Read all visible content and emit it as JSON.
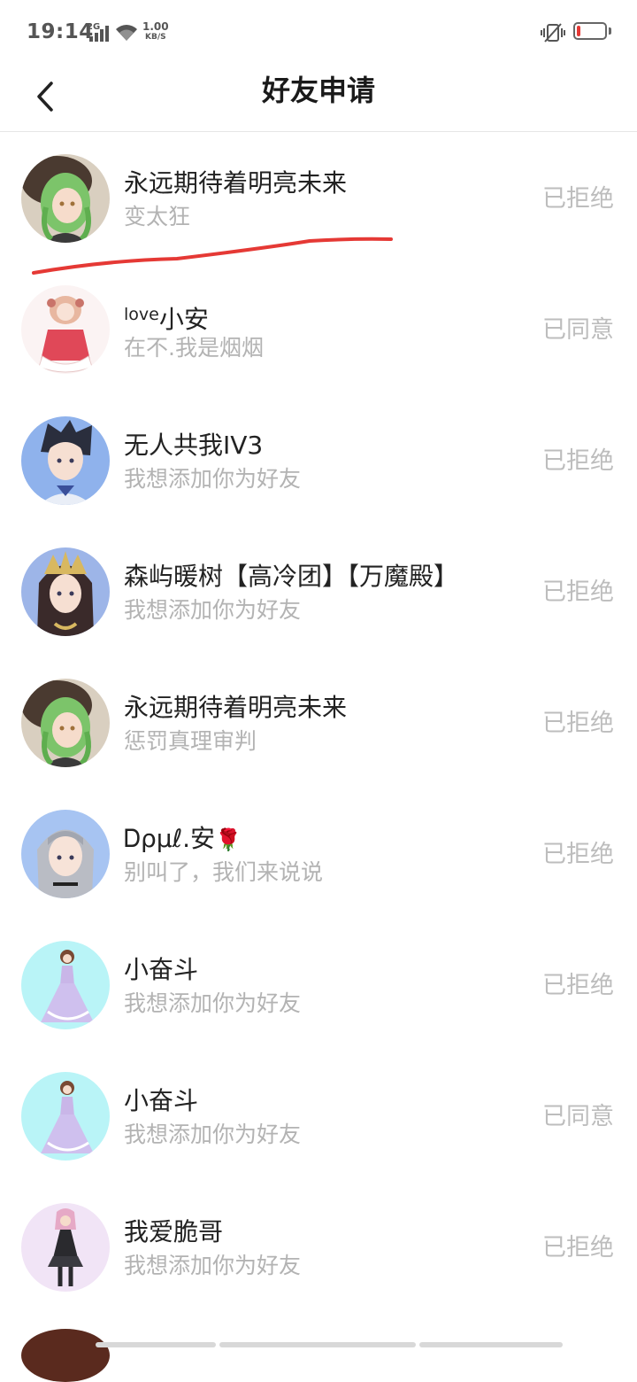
{
  "status_bar": {
    "time": "19:14",
    "network": "2G",
    "speed_value": "1.00",
    "speed_unit": "KB/S",
    "battery_color": "#e53935"
  },
  "header": {
    "title": "好友申请",
    "back_icon": "chevron-left-icon"
  },
  "requests": [
    {
      "name": "永远期待着明亮未来",
      "message": "变太狂",
      "status": "已拒绝",
      "avatar": "green-hair-avatar"
    },
    {
      "name_sup": "love",
      "name": "小安",
      "message": "在不.我是烟烟",
      "status": "已同意",
      "avatar": "pink-dress-avatar"
    },
    {
      "name": "无人共我IV3",
      "message": "我想添加你为好友",
      "status": "已拒绝",
      "avatar": "dark-hair-boy-avatar"
    },
    {
      "name": "森屿暖树【高冷团】【万魔殿】",
      "message": "我想添加你为好友",
      "status": "已拒绝",
      "avatar": "crown-girl-avatar"
    },
    {
      "name": "永远期待着明亮未来",
      "message": "惩罚真理审判",
      "status": "已拒绝",
      "avatar": "green-hair-avatar"
    },
    {
      "name": "Ꭰρμℓ.安",
      "name_emoji": "🌹",
      "message": "别叫了，我们来说说",
      "status": "已拒绝",
      "avatar": "silver-hair-avatar"
    },
    {
      "name": "小奋斗",
      "message": "我想添加你为好友",
      "status": "已拒绝",
      "avatar": "gown-girl-avatar"
    },
    {
      "name": "小奋斗",
      "message": "我想添加你为好友",
      "status": "已同意",
      "avatar": "gown-girl-avatar"
    },
    {
      "name": "我爱脆哥",
      "message": "我想添加你为好友",
      "status": "已拒绝",
      "avatar": "black-dress-avatar"
    }
  ]
}
